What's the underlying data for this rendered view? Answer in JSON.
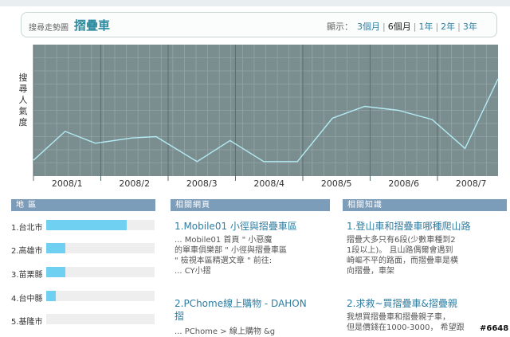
{
  "header": {
    "subtitle": "搜尋走勢圖",
    "title": "摺疊車",
    "range_label": "顯示：",
    "range_options": [
      "3個月",
      "6個月",
      "1年",
      "2年",
      "3年"
    ],
    "active_range": "6個月"
  },
  "chart_data": {
    "type": "line",
    "ylabel": "搜尋人氣度",
    "xlabel": "",
    "x_tick_labels": [
      "2008/1",
      "2008/2",
      "2008/3",
      "2008/4",
      "2008/5",
      "2008/6",
      "2008/7"
    ],
    "x_tick_positions": [
      1,
      2,
      3,
      4,
      5,
      6,
      7
    ],
    "ylim": [
      0,
      100
    ],
    "grid": true,
    "series": [
      {
        "x": [
          0.5,
          0.97,
          1.42,
          1.96,
          2.32,
          2.93,
          3.42,
          3.92,
          4.42,
          4.94,
          5.42,
          5.92,
          6.42,
          6.91,
          7.4
        ],
        "values": [
          12,
          34,
          25,
          29,
          30,
          11,
          27,
          11,
          11,
          44,
          53,
          50,
          43,
          21,
          74
        ]
      }
    ],
    "line_color": "#b3ecf4",
    "plot_background": "#7a8d8f",
    "grid_color": "#95a5a7"
  },
  "sections": {
    "region": "地 區",
    "pages": "相關網頁",
    "knowledge": "相關知識"
  },
  "regions": [
    {
      "name": "1.台北市",
      "level": 0.74
    },
    {
      "name": "2.高雄市",
      "level": 0.18
    },
    {
      "name": "3.苗栗縣",
      "level": 0.18
    },
    {
      "name": "4.台中縣",
      "level": 0.09
    },
    {
      "name": "5.基隆市",
      "level": 0.0
    }
  ],
  "pages": [
    {
      "title": "1.Mobile01 小徑與摺疊車區",
      "snippet": [
        "... Mobile01 首頁 \" 小惡魔",
        "的單車俱樂部 \" 小徑與摺疊車區",
        "\" 檢視本區精選文章 \" 前往:",
        "... CY小摺"
      ]
    },
    {
      "title": "2.PChome線上購物 - DAHON",
      "title2": "摺",
      "snippet": [
        "... PChome > 線上購物 &g"
      ]
    }
  ],
  "knowledge": [
    {
      "title": "1.登山車和摺疊車哪種爬山路",
      "snippet": [
        "摺疊大多只有6段(少數車種到2",
        "1段以上)。 且山路偶爾會遇到",
        "崎嶇不平的路面，而摺疊車是橫",
        "向摺疊，車架"
      ]
    },
    {
      "title": "2.求救~買摺疊車&摺疊親",
      "snippet": [
        "我想買摺疊車和摺疊親子車，",
        "但是價錢在1000-3000， 希望跟"
      ]
    }
  ],
  "watermark": "#6648",
  "colors": {
    "accent": "#2e8ba0",
    "link": "#2e7da0",
    "section_bg": "#7c9dba",
    "bar_fill": "#6fd0f2"
  }
}
